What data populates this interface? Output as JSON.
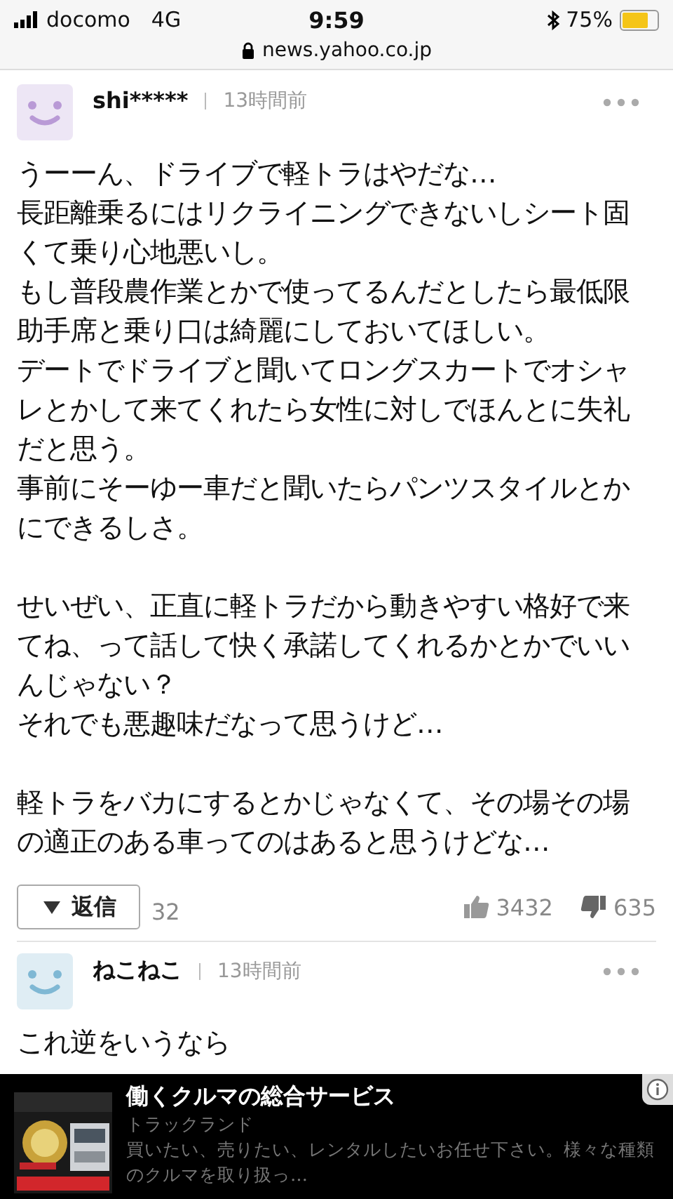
{
  "status_bar": {
    "carrier": "docomo",
    "network": "4G",
    "time": "9:59",
    "battery": "75%",
    "url": "news.yahoo.co.jp"
  },
  "comments": [
    {
      "user": "shi*****",
      "time": "13時間前",
      "color": "#b99ad6",
      "paragraphs": [
        [
          "うーーん、ドライブで軽トラはやだな…",
          "長距離乗るにはリクライニングできないしシート固",
          "くて乗り心地悪いし。",
          "もし普段農作業とかで使ってるんだとしたら最低限",
          "助手席と乗り口は綺麗にしておいてほしい。",
          "デートでドライブと聞いてロングスカートでオシャ",
          "レとかして来てくれたら女性に対しでほんとに失礼",
          "だと思う。",
          "事前にそーゆー車だと聞いたらパンツスタイルとか",
          "にできるしさ。"
        ],
        [
          "せいぜい、正直に軽トラだから動きやすい格好で来",
          "てね、って話して快く承諾してくれるかとかでいい",
          "んじゃない？",
          "それでも悪趣味だなって思うけど…"
        ],
        [
          "軽トラをバカにするとかじゃなくて、その場その場",
          "の適正のある車ってのはあると思うけどな…"
        ]
      ],
      "reply_label": "返信",
      "reply_count": "32",
      "likes": "3432",
      "dislikes": "635"
    },
    {
      "user": "ねこねこ",
      "time": "13時間前",
      "color": "#7fb8d4",
      "paragraphs": [
        [
          "これ逆をいうなら"
        ]
      ]
    }
  ],
  "ad": {
    "title": "働くクルマの総合サービス",
    "advertiser": "トラックランド",
    "description": [
      "買いたい、売りたい、レンタルしたいお任せ下さい。様々な種類",
      "のクルマを取り扱っ…"
    ],
    "image": {
      "kind": "picture"
    }
  }
}
